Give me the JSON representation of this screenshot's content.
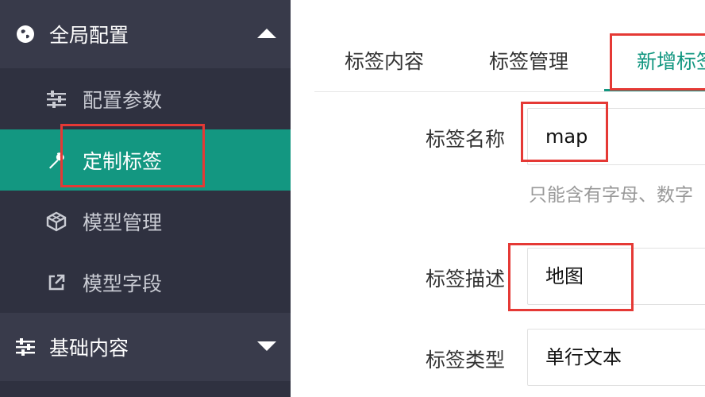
{
  "sidebar": {
    "group1": {
      "label": "全局配置",
      "icon": "globe-icon",
      "state": "expanded"
    },
    "items": [
      {
        "label": "配置参数",
        "icon": "sliders-icon",
        "active": false
      },
      {
        "label": "定制标签",
        "icon": "wrench-icon",
        "active": true
      },
      {
        "label": "模型管理",
        "icon": "cube-icon",
        "active": false
      },
      {
        "label": "模型字段",
        "icon": "external-link-icon",
        "active": false
      }
    ],
    "group2": {
      "label": "基础内容",
      "icon": "sliders-icon",
      "state": "collapsed"
    }
  },
  "tabs": [
    {
      "label": "标签内容"
    },
    {
      "label": "标签管理"
    },
    {
      "label": "新增标签",
      "active": true
    }
  ],
  "form": {
    "name_label": "标签名称",
    "name_value": "map",
    "hint": "只能含有字母、数字",
    "desc_label": "标签描述",
    "desc_value": "地图",
    "type_label": "标签类型",
    "type_value": "单行文本"
  },
  "colors": {
    "sidebar_bg": "#2f3140",
    "accent": "#139781",
    "annotation": "#e53935"
  }
}
